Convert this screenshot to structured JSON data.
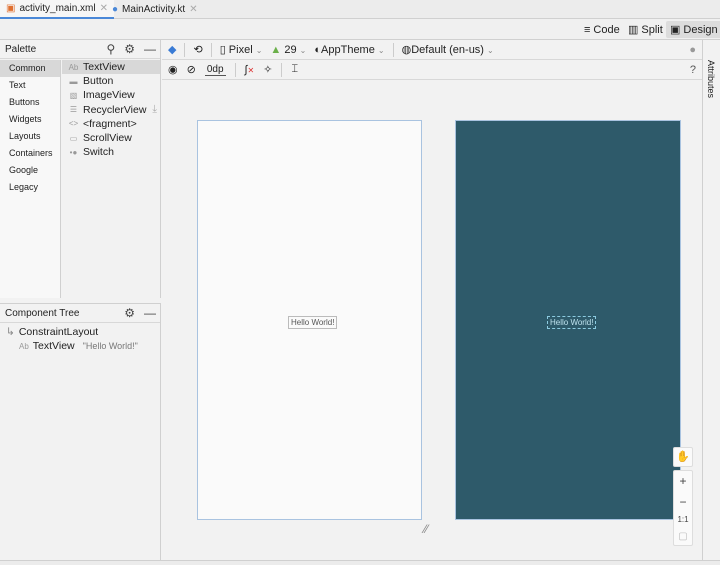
{
  "tabs": [
    {
      "label": "activity_main.xml",
      "active": true
    },
    {
      "label": "MainActivity.kt",
      "active": false
    }
  ],
  "modes": {
    "code": "Code",
    "split": "Split",
    "design": "Design",
    "selected": "Design"
  },
  "palette": {
    "title": "Palette",
    "categories": [
      "Common",
      "Text",
      "Buttons",
      "Widgets",
      "Layouts",
      "Containers",
      "Google",
      "Legacy"
    ],
    "selected_category": "Common",
    "items": [
      {
        "icon": "Ab",
        "label": "TextView"
      },
      {
        "icon": "▬",
        "label": "Button"
      },
      {
        "icon": "▧",
        "label": "ImageView"
      },
      {
        "icon": "☰",
        "label": "RecyclerView"
      },
      {
        "icon": "<>",
        "label": "<fragment>"
      },
      {
        "icon": "▭",
        "label": "ScrollView"
      },
      {
        "icon": "•●",
        "label": "Switch"
      }
    ]
  },
  "component_tree": {
    "title": "Component Tree",
    "root": "ConstraintLayout",
    "child_icon": "Ab",
    "child": "TextView",
    "child_text": "\"Hello World!\""
  },
  "toolbar": {
    "device": "Pixel",
    "api": "29",
    "theme": "AppTheme",
    "locale": "Default (en-us)",
    "margin": "0dp"
  },
  "attributes_label": "Attributes",
  "canvas": {
    "text": "Hello World!",
    "design_bg": "#2e5a6a"
  },
  "zoom": {
    "plus": "+",
    "minus": "−",
    "one_to_one": "1:1"
  }
}
